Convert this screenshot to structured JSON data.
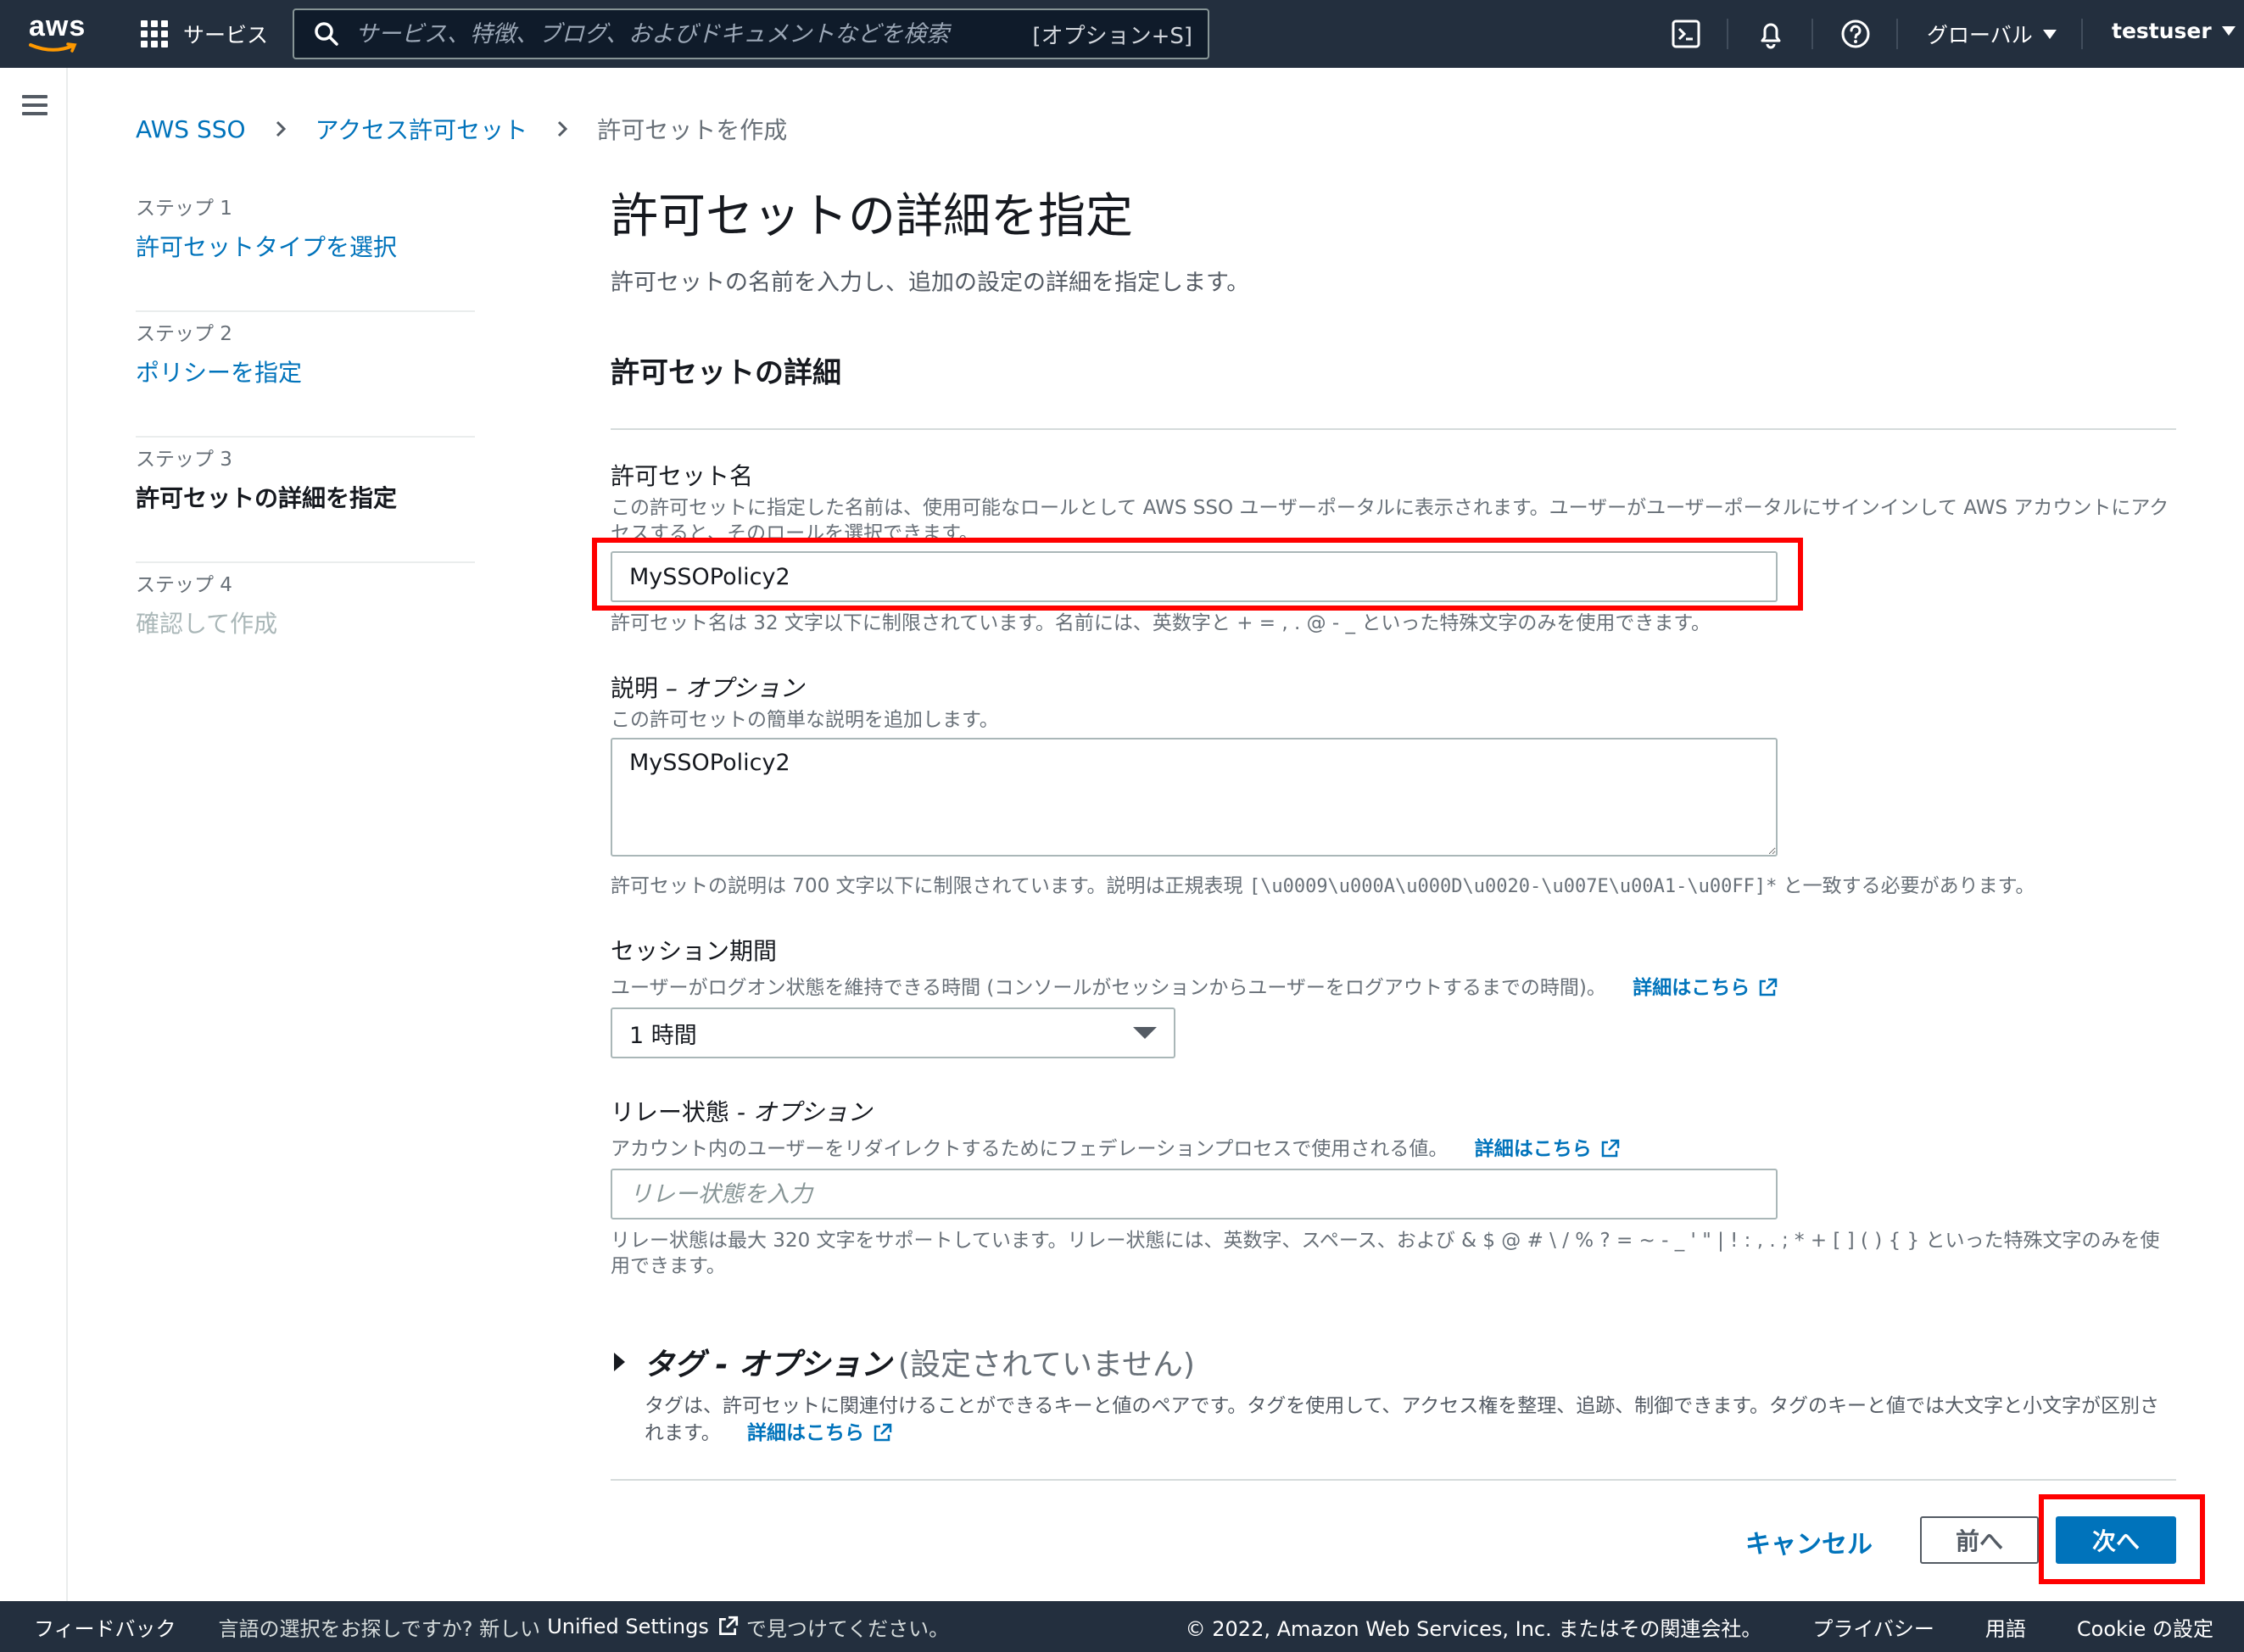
{
  "topnav": {
    "logo_text": "aws",
    "services_label": "サービス",
    "search_placeholder": "サービス、特徴、ブログ、およびドキュメントなどを検索",
    "search_shortcut": "[オプション+S]",
    "region_label": "グローバル",
    "user_label": "testuser"
  },
  "breadcrumb": {
    "items": [
      "AWS SSO",
      "アクセス許可セット"
    ],
    "current": "許可セットを作成"
  },
  "steps": [
    {
      "num": "ステップ 1",
      "label": "許可セットタイプを選択",
      "state": "link"
    },
    {
      "num": "ステップ 2",
      "label": "ポリシーを指定",
      "state": "link"
    },
    {
      "num": "ステップ 3",
      "label": "許可セットの詳細を指定",
      "state": "active"
    },
    {
      "num": "ステップ 4",
      "label": "確認して作成",
      "state": "disabled"
    }
  ],
  "main": {
    "title": "許可セットの詳細を指定",
    "description": "許可セットの名前を入力し、追加の設定の詳細を指定します。",
    "section_title": "許可セットの詳細"
  },
  "name_field": {
    "label": "許可セット名",
    "desc": "この許可セットに指定した名前は、使用可能なロールとして AWS SSO ユーザーポータルに表示されます。ユーザーがユーザーポータルにサインインして AWS アカウントにアクセスすると、そのロールを選択できます。",
    "value": "MySSOPolicy2",
    "constraint": "許可セット名は 32 文字以下に制限されています。名前には、英数字と + = , . @ - _ といった特殊文字のみを使用できます。"
  },
  "desc_field": {
    "label": "説明",
    "label_optional": "– オプション",
    "desc": "この許可セットの簡単な説明を追加します。",
    "value": "MySSOPolicy2",
    "constraint_pre": "許可セットの説明は 700 文字以下に制限されています。説明は正規表現 ",
    "constraint_code": "[\\u0009\\u000A\\u000D\\u0020-\\u007E\\u00A1-\\u00FF]*",
    "constraint_post": " と一致する必要があります。"
  },
  "session_field": {
    "label": "セッション期間",
    "desc": "ユーザーがログオン状態を維持できる時間 (コンソールがセッションからユーザーをログアウトするまでの時間)。",
    "link": "詳細はこちら",
    "value": "1 時間"
  },
  "relay_field": {
    "label": "リレー状態",
    "label_optional": "- オプション",
    "desc": "アカウント内のユーザーをリダイレクトするためにフェデレーションプロセスで使用される値。",
    "link": "詳細はこちら",
    "placeholder": "リレー状態を入力",
    "constraint": "リレー状態は最大 320 文字をサポートしています。リレー状態には、英数字、スペース、および & $ @ # \\ / % ? = ~ - _ ' \" | ! : , . ; * + [ ] ( ) { } といった特殊文字のみを使用できます。"
  },
  "tags": {
    "title": "タグ - オプション",
    "status": "(設定されていません)",
    "desc": "タグは、許可セットに関連付けることができるキーと値のペアです。タグを使用して、アクセス権を整理、追跡、制御できます。タグのキーと値では大文字と小文字が区別されます。",
    "link": "詳細はこちら"
  },
  "actions": {
    "cancel": "キャンセル",
    "previous": "前へ",
    "next": "次へ"
  },
  "footer": {
    "feedback": "フィードバック",
    "lang_prompt": "言語の選択をお探しですか? 新しい",
    "unified_settings": "Unified Settings",
    "lang_suffix": "で見つけてください。",
    "copyright": "© 2022, Amazon Web Services, Inc. またはその関連会社。",
    "privacy": "プライバシー",
    "terms": "用語",
    "cookie": "Cookie の設定"
  },
  "colors": {
    "nav_bg": "#232f3e",
    "link": "#0073bb",
    "primary_button": "#0073bb",
    "highlight": "#ff0000"
  }
}
